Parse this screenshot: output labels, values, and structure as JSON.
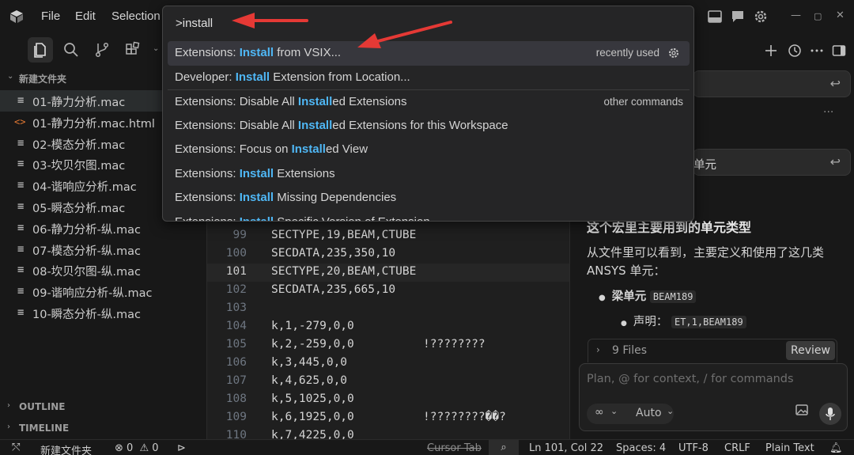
{
  "menu": {
    "file": "File",
    "edit": "Edit",
    "selection": "Selection"
  },
  "sidebar": {
    "folder": "新建文件夹",
    "files": [
      {
        "name": "01-静力分析.mac",
        "type": "mac",
        "selected": true
      },
      {
        "name": "01-静力分析.mac.html",
        "type": "html",
        "selected": false
      },
      {
        "name": "02-模态分析.mac",
        "type": "mac",
        "selected": false
      },
      {
        "name": "03-坎贝尔图.mac",
        "type": "mac",
        "selected": false
      },
      {
        "name": "04-谐响应分析.mac",
        "type": "mac",
        "selected": false
      },
      {
        "name": "05-瞬态分析.mac",
        "type": "mac",
        "selected": false
      },
      {
        "name": "06-静力分析-纵.mac",
        "type": "mac",
        "selected": false
      },
      {
        "name": "07-模态分析-纵.mac",
        "type": "mac",
        "selected": false
      },
      {
        "name": "08-坎贝尔图-纵.mac",
        "type": "mac",
        "selected": false
      },
      {
        "name": "09-谐响应分析-纵.mac",
        "type": "mac",
        "selected": false
      },
      {
        "name": "10-瞬态分析-纵.mac",
        "type": "mac",
        "selected": false
      }
    ],
    "outline": "OUTLINE",
    "timeline": "TIMELINE"
  },
  "editor": {
    "lines": [
      {
        "no": "99",
        "text": "SECTYPE,19,BEAM,CTUBE",
        "current": false
      },
      {
        "no": "100",
        "text": "SECDATA,235,350,10",
        "current": false
      },
      {
        "no": "101",
        "text": "SECTYPE,20,BEAM,CTUBE",
        "current": true
      },
      {
        "no": "102",
        "text": "SECDATA,235,665,10",
        "current": false
      },
      {
        "no": "103",
        "text": "",
        "current": false
      },
      {
        "no": "104",
        "text": "k,1,-279,0,0",
        "current": false
      },
      {
        "no": "105",
        "text": "k,2,-259,0,0          !????????",
        "current": false
      },
      {
        "no": "106",
        "text": "k,3,445,0,0",
        "current": false
      },
      {
        "no": "107",
        "text": "k,4,625,0,0",
        "current": false
      },
      {
        "no": "108",
        "text": "k,5,1025,0,0",
        "current": false
      },
      {
        "no": "109",
        "text": "k,6,1925,0,0          !????????��?",
        "current": false
      },
      {
        "no": "110",
        "text": "k,7,4225,0,0",
        "current": false
      }
    ]
  },
  "palette": {
    "query": ">install",
    "items": [
      {
        "pre": "Extensions: ",
        "hl": "Install",
        "post": " from VSIX...",
        "meta": "recently used",
        "gear": true,
        "active": true,
        "sep": false
      },
      {
        "pre": "Developer: ",
        "hl": "Install",
        "post": " Extension from Location...",
        "meta": "",
        "gear": false,
        "active": false,
        "sep": false
      },
      {
        "pre": "Extensions: Disable All ",
        "hl": "Install",
        "post": "ed Extensions",
        "meta": "other commands",
        "gear": false,
        "active": false,
        "sep": true
      },
      {
        "pre": "Extensions: Disable All ",
        "hl": "Install",
        "post": "ed Extensions for this Workspace",
        "meta": "",
        "gear": false,
        "active": false,
        "sep": false
      },
      {
        "pre": "Extensions: Focus on ",
        "hl": "Install",
        "post": "ed View",
        "meta": "",
        "gear": false,
        "active": false,
        "sep": false
      },
      {
        "pre": "Extensions: ",
        "hl": "Install",
        "post": " Extensions",
        "meta": "",
        "gear": false,
        "active": false,
        "sep": false
      },
      {
        "pre": "Extensions: ",
        "hl": "Install",
        "post": " Missing Dependencies",
        "meta": "",
        "gear": false,
        "active": false,
        "sep": false
      },
      {
        "pre": "Extensions: ",
        "hl": "Install",
        "post": " Specific Version of Extension...",
        "meta": "",
        "gear": false,
        "active": false,
        "sep": false
      }
    ]
  },
  "chat": {
    "bubble2_text": "单元",
    "heading": "这个宏里主要用到的单元类型",
    "paragraph": "从文件里可以看到，主要定义和使用了这几类 ANSYS 单元：",
    "bullet1_label": "梁单元",
    "bullet1_code": "BEAM189",
    "bullet2_label": "声明：",
    "bullet2_code": "ET,1,BEAM189",
    "files_label": "9 Files",
    "review": "Review",
    "input_placeholder": "Plan, @ for context, / for commands",
    "mode": "Auto"
  },
  "status": {
    "folder": "新建文件夹",
    "errors": "0",
    "warnings": "0",
    "cursor_tab": "Cursor Tab",
    "position": "Ln 101, Col 22",
    "spaces": "Spaces: 4",
    "encoding": "UTF-8",
    "eol": "CRLF",
    "language": "Plain Text"
  },
  "colors": {
    "accent_highlight": "#4fb7f5",
    "annotation_arrow": "#e53935"
  }
}
